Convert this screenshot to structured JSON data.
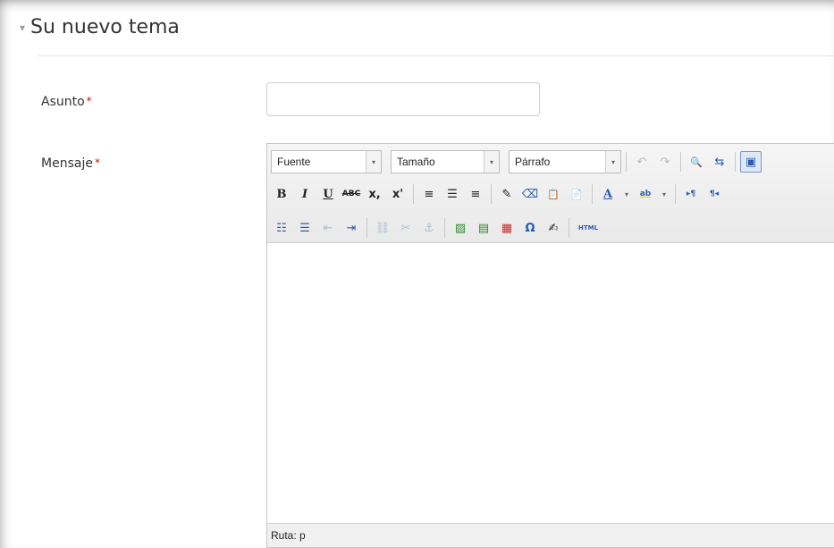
{
  "section": {
    "caret": "▾",
    "title": "Su nuevo tema"
  },
  "fields": {
    "subject_label": "Asunto",
    "message_label": "Mensaje",
    "required_mark": "*",
    "subject_value": ""
  },
  "toolbar": {
    "font_label": "Fuente",
    "size_label": "Tamaño",
    "format_label": "Párrafo",
    "dropdown_arrow": "▾",
    "row1": [
      {
        "name": "undo-icon",
        "glyph": "↶",
        "dim": true
      },
      {
        "name": "redo-icon",
        "glyph": "↷",
        "dim": true
      },
      {
        "name": "find-icon",
        "glyph": "🔍"
      },
      {
        "name": "replace-icon",
        "glyph": "⇆"
      },
      {
        "name": "fullscreen-icon",
        "glyph": "▣"
      }
    ],
    "row2_text": {
      "bold": "B",
      "italic": "I",
      "underline": "U",
      "strike": "ABC",
      "subscript": "x,",
      "superscript": "x'",
      "font_color": "A",
      "highlight": "ab"
    },
    "row2_icons": [
      {
        "name": "align-left-icon",
        "glyph": "≡"
      },
      {
        "name": "align-center-icon",
        "glyph": "☰"
      },
      {
        "name": "align-right-icon",
        "glyph": "≡"
      },
      {
        "name": "clean-format-icon",
        "glyph": "✎"
      },
      {
        "name": "eraser-icon",
        "glyph": "⌫"
      },
      {
        "name": "paste-text-icon",
        "glyph": "📋"
      },
      {
        "name": "paste-word-icon",
        "glyph": "📄"
      }
    ],
    "row2_dir": [
      {
        "name": "ltr-icon",
        "glyph": "▸¶"
      },
      {
        "name": "rtl-icon",
        "glyph": "¶◂"
      }
    ],
    "row3": [
      {
        "name": "bullet-list-icon",
        "glyph": "☷"
      },
      {
        "name": "numbered-list-icon",
        "glyph": "☰"
      },
      {
        "name": "outdent-icon",
        "glyph": "⇤",
        "dim": true
      },
      {
        "name": "indent-icon",
        "glyph": "⇥"
      },
      {
        "name": "link-icon",
        "glyph": "⛓",
        "dim": true
      },
      {
        "name": "unlink-icon",
        "glyph": "✂",
        "dim": true
      },
      {
        "name": "anchor-icon",
        "glyph": "⚓",
        "dim": true
      },
      {
        "name": "insert-image-icon",
        "glyph": "▨",
        "color": "green"
      },
      {
        "name": "insert-media-icon",
        "glyph": "▤",
        "color": "green"
      },
      {
        "name": "insert-file-icon",
        "glyph": "▦",
        "color": "red"
      },
      {
        "name": "special-char-icon",
        "glyph": "Ω",
        "color": "blue"
      },
      {
        "name": "edit-icon",
        "glyph": "✍"
      },
      {
        "name": "html-icon",
        "glyph": "HTML"
      }
    ]
  },
  "status": {
    "path_label": "Ruta: p"
  }
}
